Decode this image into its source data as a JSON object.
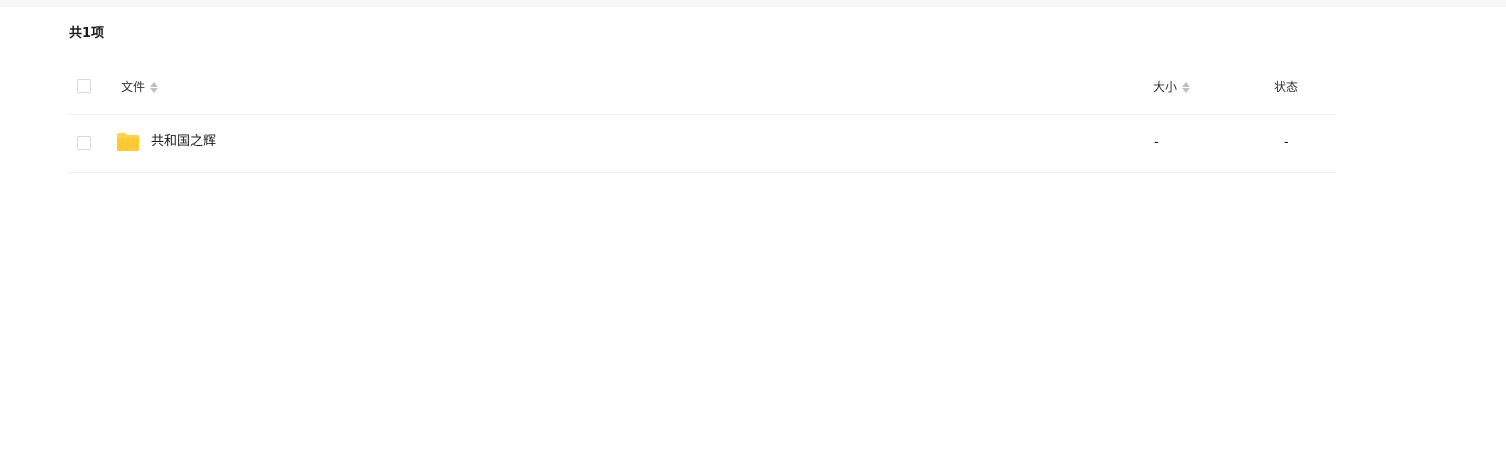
{
  "summary": {
    "count_label": "共1项"
  },
  "table": {
    "columns": {
      "file": "文件",
      "size": "大小",
      "status": "状态"
    },
    "rows": [
      {
        "name": "共和国之辉",
        "icon": "folder-icon",
        "size": "-",
        "status": "-"
      }
    ]
  },
  "colors": {
    "folder": "#FFD24F",
    "divider": "#F0F0F0",
    "sort_arrow": "#C0C0C0"
  }
}
